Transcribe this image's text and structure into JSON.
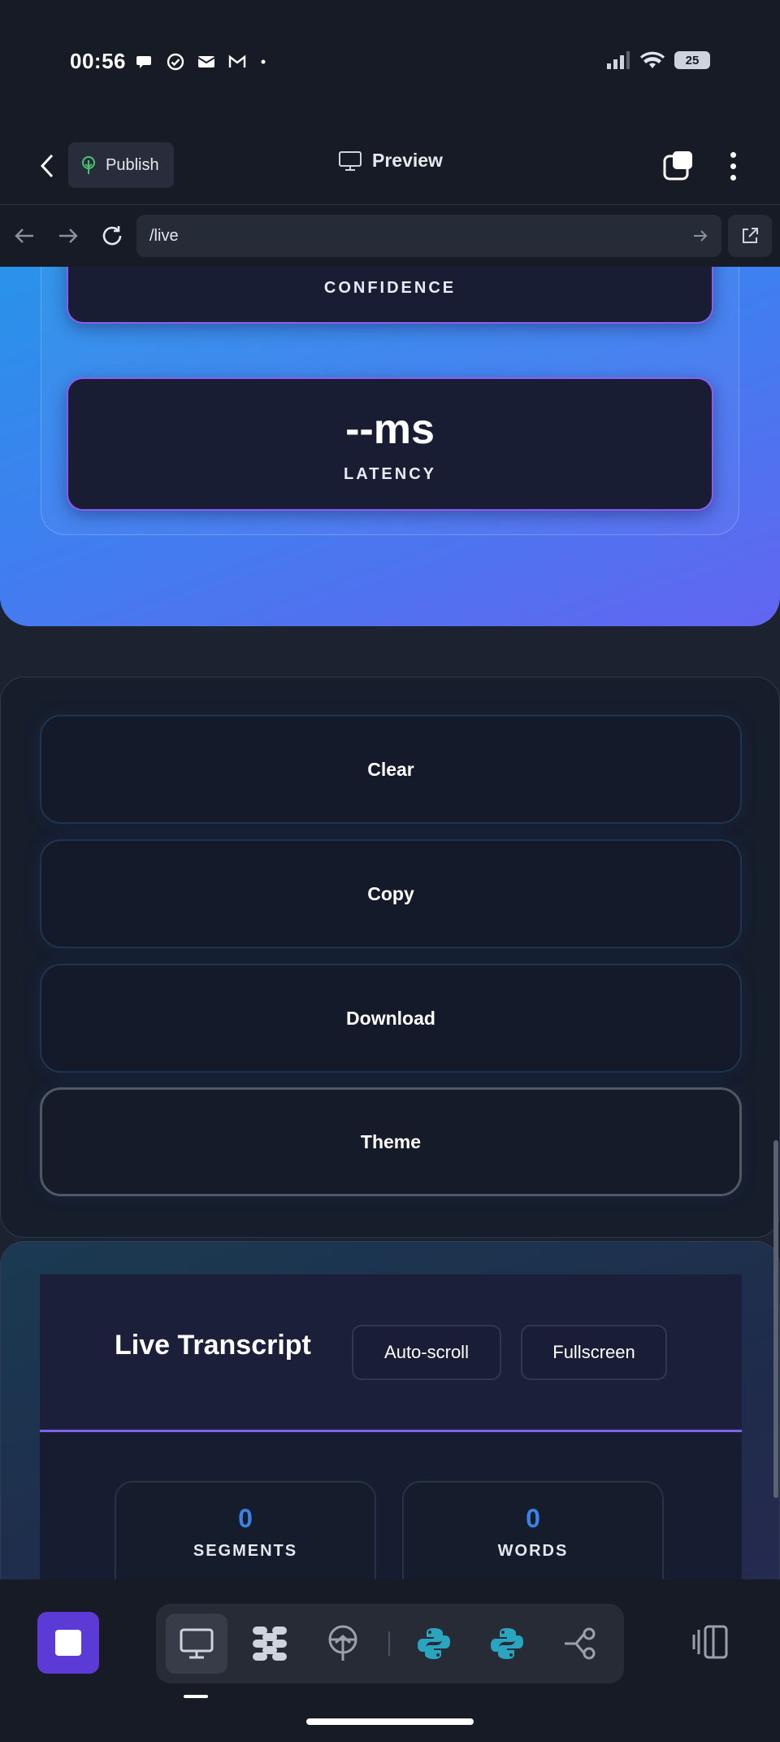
{
  "status": {
    "time": "00:56",
    "battery": "25"
  },
  "appbar": {
    "publish_label": "Publish",
    "preview_label": "Preview"
  },
  "urlbar": {
    "url": "/live"
  },
  "metrics": {
    "confidence_value": "--%",
    "confidence_label": "CONFIDENCE",
    "latency_value": "--ms",
    "latency_label": "LATENCY"
  },
  "controls": {
    "clear": "Clear",
    "copy": "Copy",
    "download": "Download",
    "theme": "Theme"
  },
  "transcript": {
    "title": "Live Transcript",
    "autoscroll": "Auto-scroll",
    "fullscreen": "Fullscreen",
    "segments_value": "0",
    "segments_label": "SEGMENTS",
    "words_value": "0",
    "words_label": "WORDS"
  },
  "colors": {
    "accent_purple": "#5b3ad6",
    "hero_gradient_start": "#2596e8",
    "hero_gradient_end": "#6265f0",
    "metric_border": "#8f5cf0",
    "stat_number": "#3b82e6",
    "python_teal": "#2ba4bf"
  },
  "dock": {
    "icons": [
      "stop-icon",
      "monitor-icon",
      "workflow-icon",
      "deploy-icon",
      "python-icon",
      "python-icon",
      "graph-icon",
      "panel-icon"
    ]
  }
}
